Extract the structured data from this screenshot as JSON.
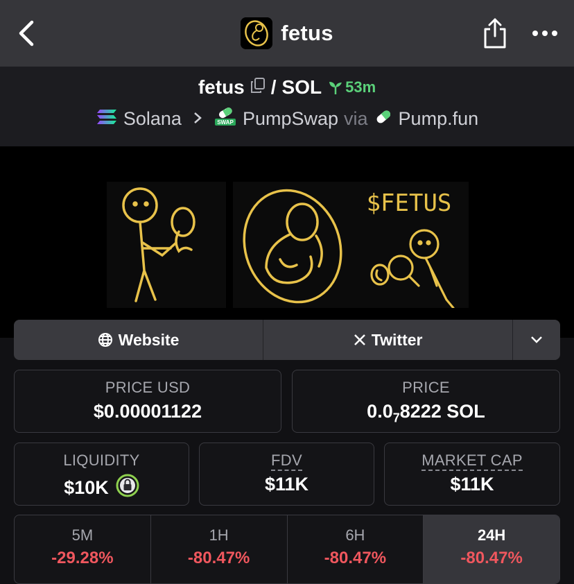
{
  "nav": {
    "title": "fetus",
    "icons": [
      "back-arrow-icon",
      "share-icon",
      "more-icon"
    ]
  },
  "pair": {
    "base": "fetus",
    "separator": "/",
    "quote": "SOL",
    "age": "53m",
    "chain": "Solana",
    "dex": "PumpSwap",
    "via_label": "via",
    "launchpad": "Pump.fun",
    "dex_badge": "SWAP"
  },
  "banner": {
    "meme_text": "$FETUS"
  },
  "links": {
    "website": "Website",
    "twitter": "Twitter"
  },
  "stats": {
    "price_usd_label": "PRICE USD",
    "price_usd": "$0.00001122",
    "price_label": "PRICE",
    "price_prefix": "0.0",
    "price_sub": "7",
    "price_suffix": "8222 SOL",
    "liquidity_label": "LIQUIDITY",
    "liquidity": "$10K",
    "fdv_label": "FDV",
    "fdv": "$11K",
    "mcap_label": "MARKET CAP",
    "mcap": "$11K"
  },
  "timeframes": [
    {
      "label": "5M",
      "change": "-29.28%"
    },
    {
      "label": "1H",
      "change": "-80.47%"
    },
    {
      "label": "6H",
      "change": "-80.47%"
    },
    {
      "label": "24H",
      "change": "-80.47%"
    }
  ],
  "colors": {
    "negative": "#f0575e",
    "positive": "#5bd17a",
    "accent_gold": "#e8c24a"
  }
}
